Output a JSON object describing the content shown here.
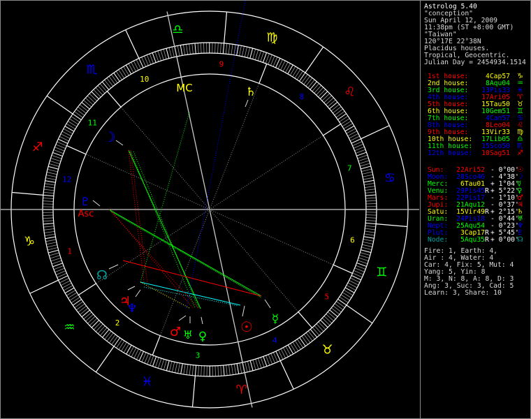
{
  "header": {
    "title": "Astrolog 5.40",
    "lines": [
      "\"conception\"",
      "Sun April 12, 2009",
      "11:38pm (ST +8:00 GMT)",
      "\"Taiwan\"",
      "120°17E 22°38N",
      "Placidus houses.",
      "Tropical, Geocentric.",
      "Julian Day = 2454934.1514"
    ]
  },
  "houses": [
    {
      "num": "1",
      "label": "1st house:",
      "value": "4Cap57",
      "glyph": "♑",
      "color": "#ff0000",
      "value_color": "#ffff00"
    },
    {
      "num": "2",
      "label": "2nd house:",
      "value": "8Aqu04",
      "glyph": "♒",
      "color": "#ffff00",
      "value_color": "#00ff00"
    },
    {
      "num": "3",
      "label": "3rd house:",
      "value": "13Pis33",
      "glyph": "♓",
      "color": "#00ff00",
      "value_color": "#0000ff"
    },
    {
      "num": "4",
      "label": "4th house:",
      "value": "17Ari05",
      "glyph": "♈",
      "color": "#0000ff",
      "value_color": "#ff0000"
    },
    {
      "num": "5",
      "label": "5th house:",
      "value": "15Tau50",
      "glyph": "♉",
      "color": "#ff0000",
      "value_color": "#ffff00"
    },
    {
      "num": "6",
      "label": "6th house:",
      "value": "10Gem51",
      "glyph": "♊",
      "color": "#ffff00",
      "value_color": "#00ff00"
    },
    {
      "num": "7",
      "label": "7th house:",
      "value": "4Can57",
      "glyph": "♋",
      "color": "#00ff00",
      "value_color": "#0000ff"
    },
    {
      "num": "8",
      "label": "8th house:",
      "value": "8Leo04",
      "glyph": "♌",
      "color": "#0000ff",
      "value_color": "#ff0000"
    },
    {
      "num": "9",
      "label": "9th house:",
      "value": "13Vir33",
      "glyph": "♍",
      "color": "#ff0000",
      "value_color": "#ffff00"
    },
    {
      "num": "10",
      "label": "10th house:",
      "value": "17Lib05",
      "glyph": "♎",
      "color": "#ffff00",
      "value_color": "#00ff00"
    },
    {
      "num": "11",
      "label": "11th house:",
      "value": "15Sco50",
      "glyph": "♏",
      "color": "#00ff00",
      "value_color": "#0000ff"
    },
    {
      "num": "12",
      "label": "12th house:",
      "value": "10Sag51",
      "glyph": "♐",
      "color": "#0000ff",
      "value_color": "#ff0000"
    }
  ],
  "planets": [
    {
      "id": "sun",
      "label": "Sun:",
      "value": "22Ari52",
      "retro": "",
      "lat": "- 0°00'",
      "glyph": "☉",
      "color": "#ff0000",
      "value_color": "#ff0000"
    },
    {
      "id": "moon",
      "label": "Moon:",
      "value": "28Sco46",
      "retro": "",
      "lat": "- 4°38'",
      "glyph": "☽",
      "color": "#0000ff",
      "value_color": "#0000ff"
    },
    {
      "id": "merc",
      "label": "Merc:",
      "value": "6Tau01",
      "retro": "",
      "lat": "+ 1°04'",
      "glyph": "☿",
      "color": "#00ff00",
      "value_color": "#ffff00"
    },
    {
      "id": "venu",
      "label": "Venu:",
      "value": "29Pis45",
      "retro": "R",
      "lat": "+ 5°22'",
      "glyph": "♀",
      "color": "#00ff00",
      "value_color": "#0000ff"
    },
    {
      "id": "mars",
      "label": "Mars:",
      "value": "22Pis17",
      "retro": "",
      "lat": "- 1°10'",
      "glyph": "♂",
      "color": "#ff0000",
      "value_color": "#0000ff"
    },
    {
      "id": "jupi",
      "label": "Jupi:",
      "value": "21Aqu12",
      "retro": "",
      "lat": "- 0°37'",
      "glyph": "♃",
      "color": "#ff0000",
      "value_color": "#00ff00"
    },
    {
      "id": "satu",
      "label": "Satu:",
      "value": "15Vir49",
      "retro": "R",
      "lat": "+ 2°15'",
      "glyph": "♄",
      "color": "#ffff00",
      "value_color": "#ffff00"
    },
    {
      "id": "uran",
      "label": "Uran:",
      "value": "24Pis18",
      "retro": "",
      "lat": "- 0°44'",
      "glyph": "♅",
      "color": "#00ff00",
      "value_color": "#0000ff"
    },
    {
      "id": "nept",
      "label": "Nept:",
      "value": "25Aqu54",
      "retro": "",
      "lat": "- 0°23'",
      "glyph": "♆",
      "color": "#0000ff",
      "value_color": "#00ff00"
    },
    {
      "id": "plut",
      "label": "Plut:",
      "value": "3Cap17",
      "retro": "R",
      "lat": "+ 5°45'",
      "glyph": "♇",
      "color": "#0000ff",
      "value_color": "#ffff00"
    },
    {
      "id": "node",
      "label": "Node:",
      "value": "5Aqu35",
      "retro": "R",
      "lat": "+ 0°00'",
      "glyph": "☊",
      "color": "#00a0a0",
      "value_color": "#00ff00"
    }
  ],
  "stats": [
    "Fire: 1, Earth: 4,",
    "Air : 4, Water: 4",
    "Car: 4, Fix: 5, Mut: 4",
    "Yang: 5, Yin: 8",
    "M: 3, N: 8, A: 8, D: 3",
    "Ang: 3, Suc: 3, Cad: 5",
    "Learn: 3, Share: 10"
  ],
  "chart_labels": {
    "asc": "Asc",
    "mc": "MC"
  },
  "signs": [
    {
      "name": "Aries",
      "glyph": "♈",
      "color": "#ff0000"
    },
    {
      "name": "Taurus",
      "glyph": "♉",
      "color": "#ffff00"
    },
    {
      "name": "Gemini",
      "glyph": "♊",
      "color": "#00ff00"
    },
    {
      "name": "Cancer",
      "glyph": "♋",
      "color": "#0000ff"
    },
    {
      "name": "Leo",
      "glyph": "♌",
      "color": "#ff0000"
    },
    {
      "name": "Virgo",
      "glyph": "♍",
      "color": "#ffff00"
    },
    {
      "name": "Libra",
      "glyph": "♎",
      "color": "#00ff00"
    },
    {
      "name": "Scorpio",
      "glyph": "♏",
      "color": "#0000ff"
    },
    {
      "name": "Sagittarius",
      "glyph": "♐",
      "color": "#ff0000"
    },
    {
      "name": "Capricorn",
      "glyph": "♑",
      "color": "#ffff00"
    },
    {
      "name": "Aquarius",
      "glyph": "♒",
      "color": "#00ff00"
    },
    {
      "name": "Pisces",
      "glyph": "♓",
      "color": "#0000ff"
    }
  ]
}
